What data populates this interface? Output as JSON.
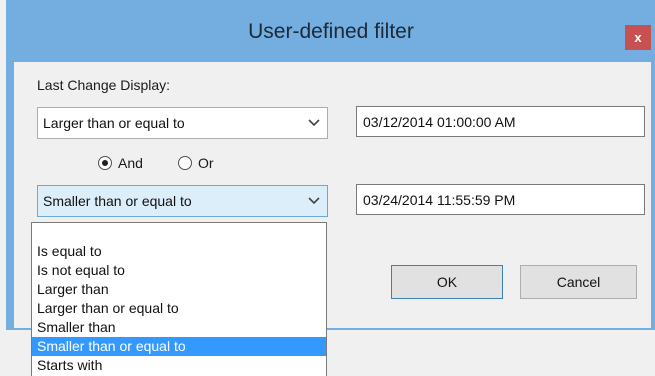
{
  "window": {
    "title": "User-defined filter",
    "close_label": "x"
  },
  "filter": {
    "field_label": "Last Change Display:",
    "condition1": {
      "operator": "Larger than or equal to",
      "value": "03/12/2014 01:00:00 AM"
    },
    "logic": {
      "and_label": "And",
      "or_label": "Or",
      "selected": "And"
    },
    "condition2": {
      "operator": "Smaller than or equal to",
      "value": "03/24/2014 11:55:59 PM"
    }
  },
  "buttons": {
    "ok": "OK",
    "cancel": "Cancel"
  },
  "dropdown": {
    "items": [
      {
        "label": "Is equal to"
      },
      {
        "label": "Is not equal to"
      },
      {
        "label": "Larger than"
      },
      {
        "label": "Larger than or equal to"
      },
      {
        "label": "Smaller than"
      },
      {
        "label": "Smaller than or equal to",
        "selected": true
      },
      {
        "label": "Starts with"
      }
    ]
  },
  "colors": {
    "titlebar": "#74aee0",
    "close_button": "#c75050",
    "selection": "#3399ff",
    "combo_active": "#ddeefb"
  },
  "icons": {
    "combo_arrow": "chevron-down-icon",
    "radio_selected": "radio-dot-icon"
  }
}
